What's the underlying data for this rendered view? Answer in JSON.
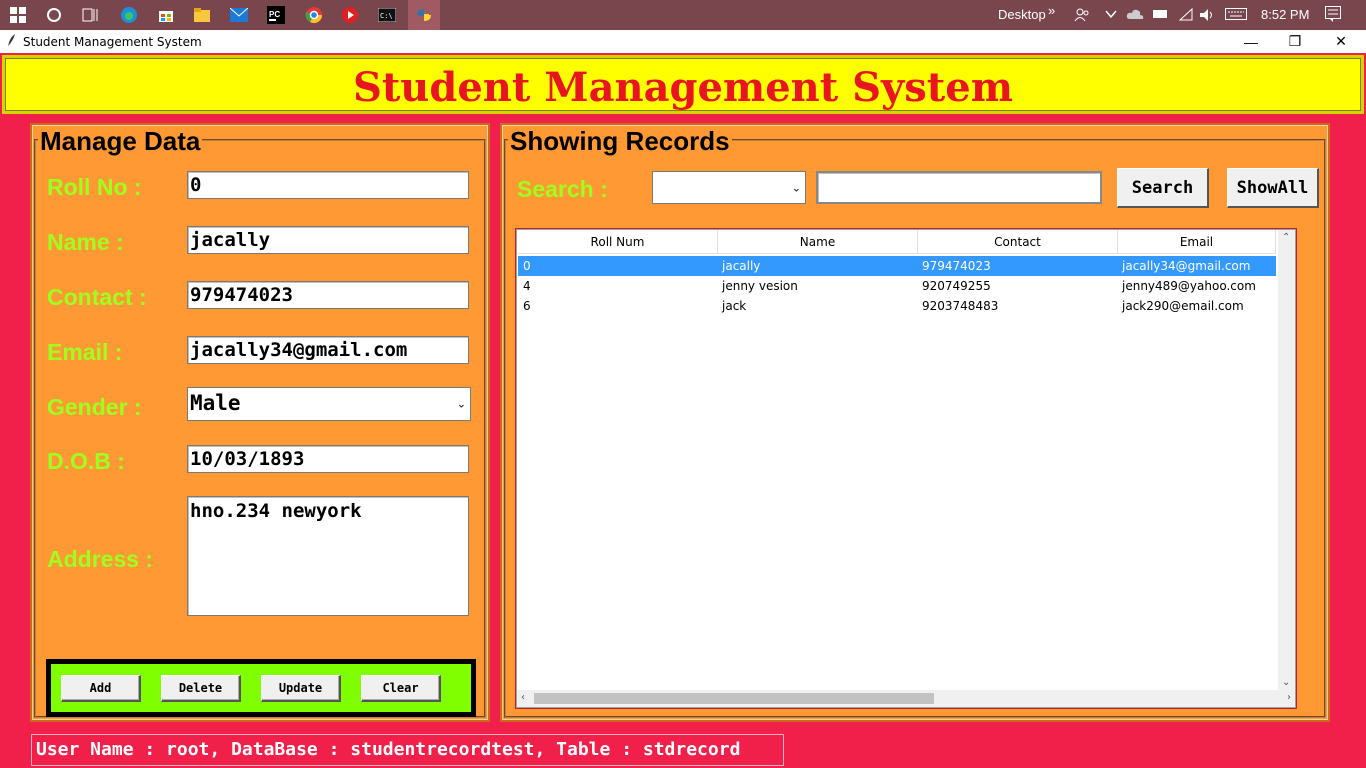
{
  "taskbar": {
    "desktop_label": "Desktop",
    "more_label": "»",
    "time": "8:52 PM"
  },
  "window": {
    "title": "Student Management System",
    "minimize": "—",
    "maximize": "❐",
    "close": "✕"
  },
  "header": {
    "title": "Student Management System"
  },
  "manage": {
    "legend": "Manage Data",
    "roll_label": "Roll No :",
    "roll_value": "0",
    "name_label": "Name :",
    "name_value": "jacally",
    "contact_label": "Contact :",
    "contact_value": "979474023",
    "email_label": "Email :",
    "email_value": "jacally34@gmail.com",
    "gender_label": "Gender  :",
    "gender_value": "Male",
    "dob_label": "D.O.B :",
    "dob_value": "10/03/1893",
    "address_label": "Address :",
    "address_value": "hno.234 newyork",
    "buttons": {
      "add": "Add",
      "delete": "Delete",
      "update": "Update",
      "clear": "Clear"
    }
  },
  "records": {
    "legend": "Showing Records",
    "search_label": "Search  :",
    "search_by_value": "",
    "search_text": "",
    "search_button": "Search",
    "showall_button": "ShowAll",
    "columns": [
      "Roll Num",
      "Name",
      "Contact",
      "Email"
    ],
    "rows": [
      {
        "roll": "0",
        "name": "jacally",
        "contact": "979474023",
        "email": "jacally34@gmail.com",
        "selected": true
      },
      {
        "roll": "4",
        "name": "jenny vesion",
        "contact": "920749255",
        "email": "jenny489@yahoo.com",
        "selected": false
      },
      {
        "roll": "6",
        "name": "jack",
        "contact": "9203748483",
        "email": "jack290@email.com",
        "selected": false
      }
    ]
  },
  "status": {
    "text": "User Name :  root,  DataBase :  studentrecordtest,  Table :  stdrecord"
  },
  "colors": {
    "background": "#f0204a",
    "panel": "#ff9933",
    "banner": "#ffff00",
    "title_text": "#e8141e",
    "label_text": "#9eff1e",
    "button_frame": "#80ff00",
    "selection": "#3399ff"
  }
}
